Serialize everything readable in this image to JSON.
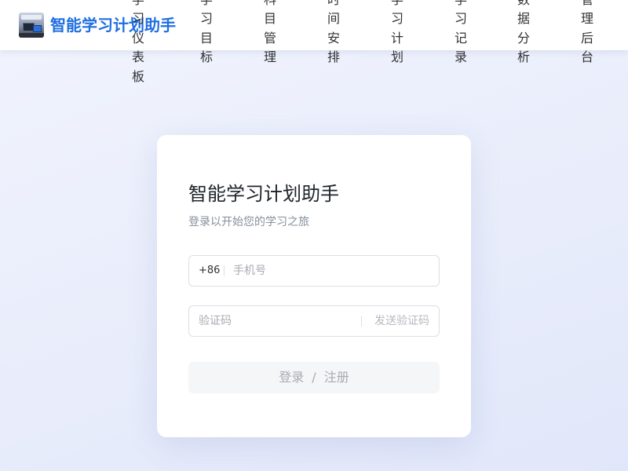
{
  "header": {
    "logo_alt": "logo",
    "brand": "智能学习计划助手",
    "nav": [
      {
        "label": "学习仪表板"
      },
      {
        "label": "学习目标"
      },
      {
        "label": "科目管理"
      },
      {
        "label": "时间安排"
      },
      {
        "label": "学习计划"
      },
      {
        "label": "学习记录"
      },
      {
        "label": "数据分析"
      },
      {
        "label": "管理后台"
      }
    ]
  },
  "login": {
    "title": "智能学习计划助手",
    "subtitle": "登录以开始您的学习之旅",
    "phone_prefix": "+86",
    "phone_placeholder": "手机号",
    "phone_value": "",
    "code_placeholder": "验证码",
    "code_value": "",
    "send_code_label": "发送验证码",
    "login_label": "登录",
    "separator": "/",
    "register_label": "注册"
  },
  "colors": {
    "brand": "#1f6fe0",
    "background": "#eceffc",
    "button_disabled_bg": "#f5f6f8"
  }
}
